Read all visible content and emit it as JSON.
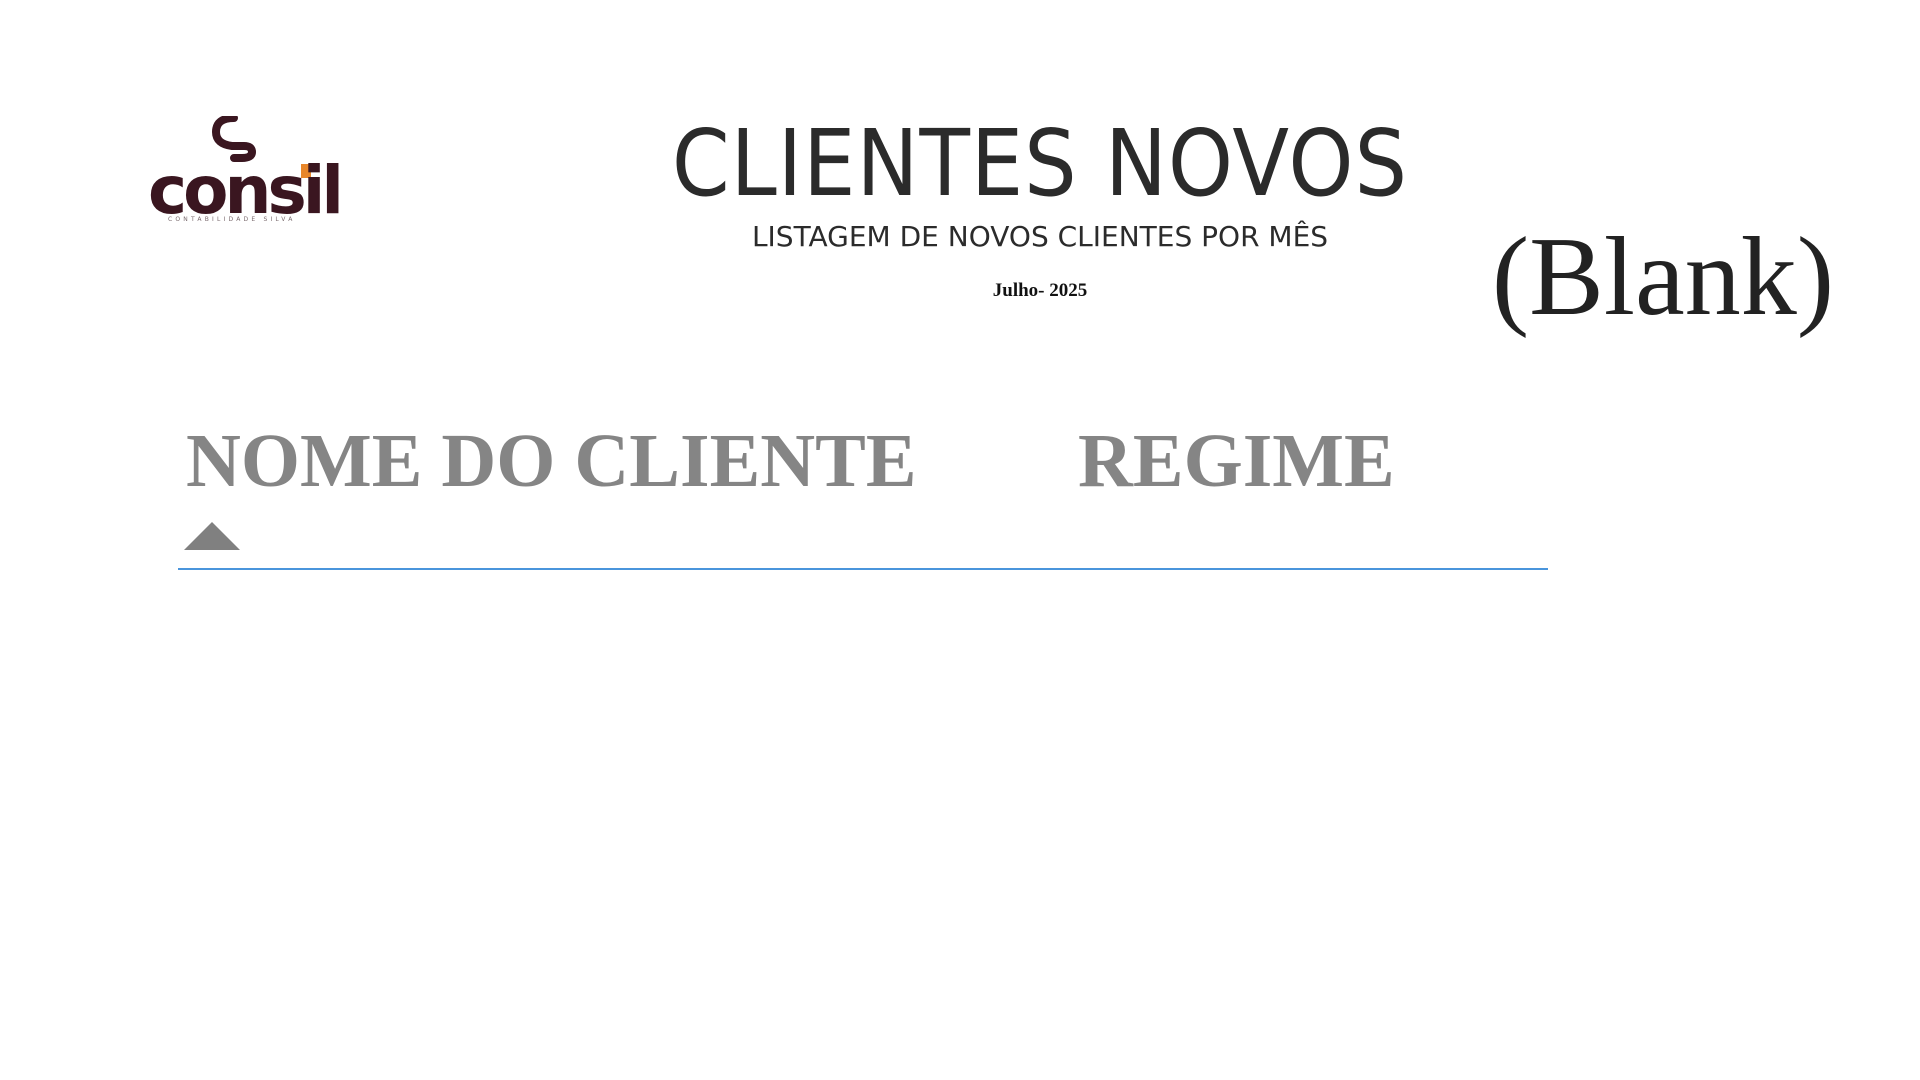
{
  "logo": {
    "name": "consil",
    "tagline": "CONTABILIDADE SILVA",
    "colors": {
      "primary": "#3a1620",
      "accent": "#e8862a"
    }
  },
  "header": {
    "title": "CLIENTES NOVOS",
    "subtitle": "LISTAGEM DE NOVOS CLIENTES POR MÊS",
    "period": "Julho- 2025"
  },
  "slicer": {
    "selected_value": "(Blank)"
  },
  "table": {
    "columns": [
      {
        "label": "NOME DO CLIENTE",
        "sort": "ascending"
      },
      {
        "label": "REGIME"
      }
    ],
    "rows": [],
    "header_rule_color": "#4a95dc",
    "header_text_color": "#858585"
  }
}
